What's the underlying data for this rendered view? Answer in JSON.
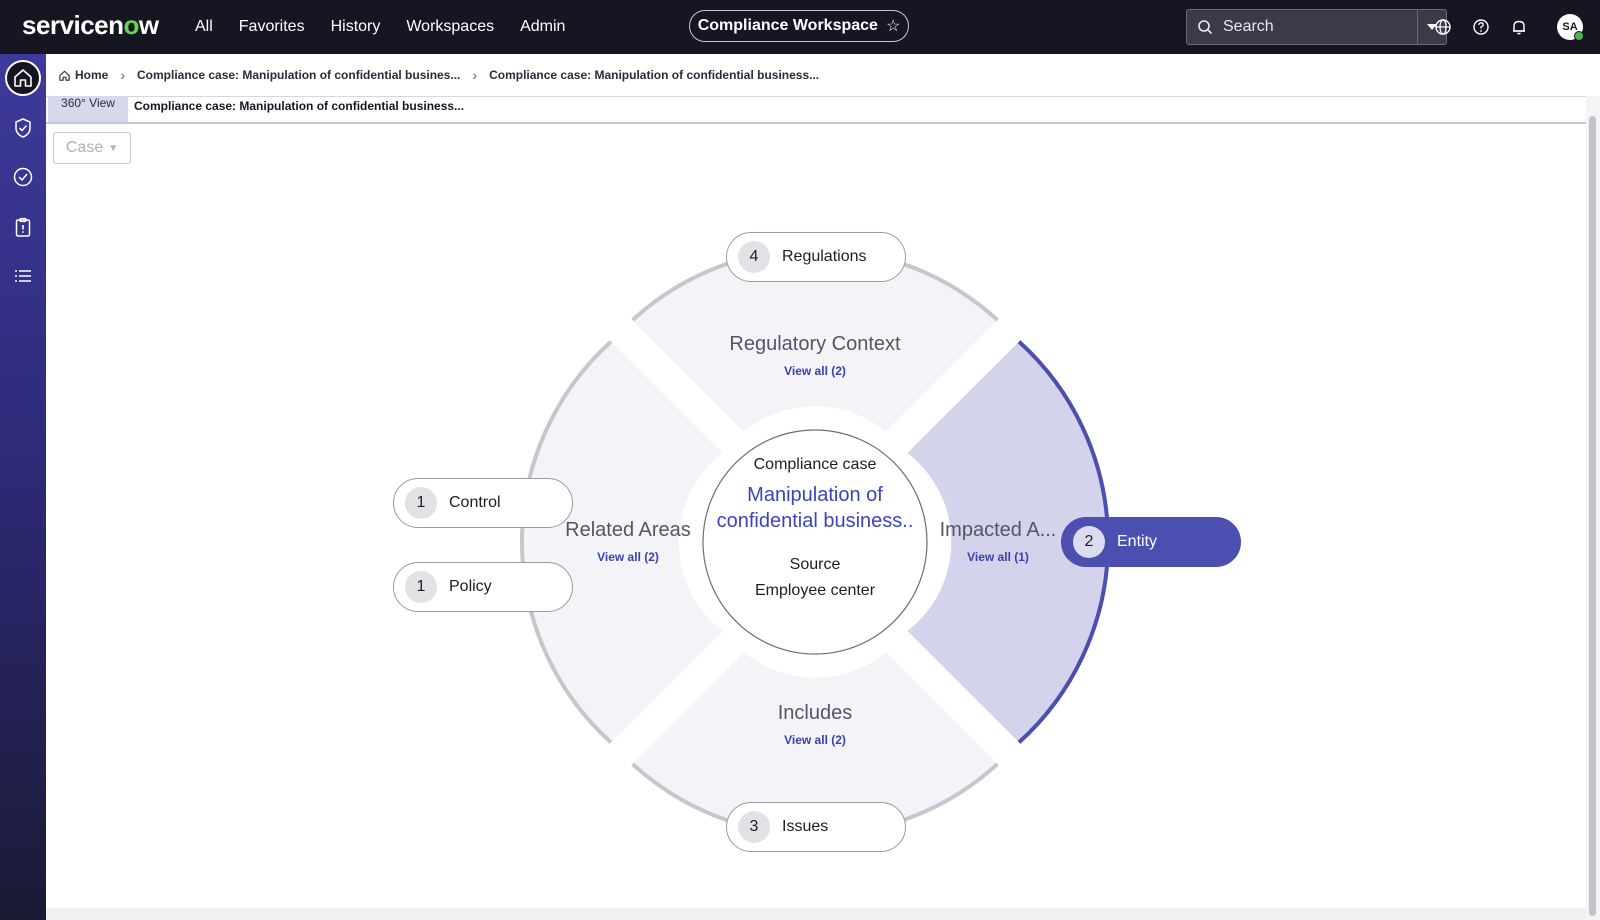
{
  "brand": {
    "name_prefix": "servicen",
    "name_o": "o",
    "name_suffix": "w",
    "accent": "#62d84e"
  },
  "topnav": [
    {
      "label": "All"
    },
    {
      "label": "Favorites"
    },
    {
      "label": "History"
    },
    {
      "label": "Workspaces"
    },
    {
      "label": "Admin"
    }
  ],
  "workspace": {
    "title": "Compliance Workspace",
    "star": "☆"
  },
  "search": {
    "placeholder": "Search"
  },
  "user": {
    "initials": "SA"
  },
  "breadcrumb": {
    "home": "Home",
    "item1": "Compliance case: Manipulation of confidential busines...",
    "item2": "Compliance case: Manipulation of confidential business..."
  },
  "tabs": {
    "view360": "360° View",
    "current": "Compliance case: Manipulation of confidential business..."
  },
  "filter": {
    "selected": "Case"
  },
  "center": {
    "type": "Compliance case",
    "title": "Manipulation of confidential business..",
    "source_label": "Source",
    "source_value": "Employee center"
  },
  "quadrants": {
    "top": {
      "title": "Regulatory Context",
      "link": "View all (2)"
    },
    "left": {
      "title": "Related Areas",
      "link": "View all (2)"
    },
    "right": {
      "title": "Impacted A...",
      "link": "View all (1)"
    },
    "bottom": {
      "title": "Includes",
      "link": "View all (2)"
    }
  },
  "pills": {
    "regulations": {
      "count": "4",
      "label": "Regulations"
    },
    "control": {
      "count": "1",
      "label": "Control"
    },
    "policy": {
      "count": "1",
      "label": "Policy"
    },
    "entity": {
      "count": "2",
      "label": "Entity"
    },
    "issues": {
      "count": "3",
      "label": "Issues"
    }
  },
  "colors": {
    "topbar": "#161622",
    "accent": "#4a4fb0",
    "highlight_fill": "#d3d4ec",
    "quad_fill": "#f4f4f8"
  }
}
